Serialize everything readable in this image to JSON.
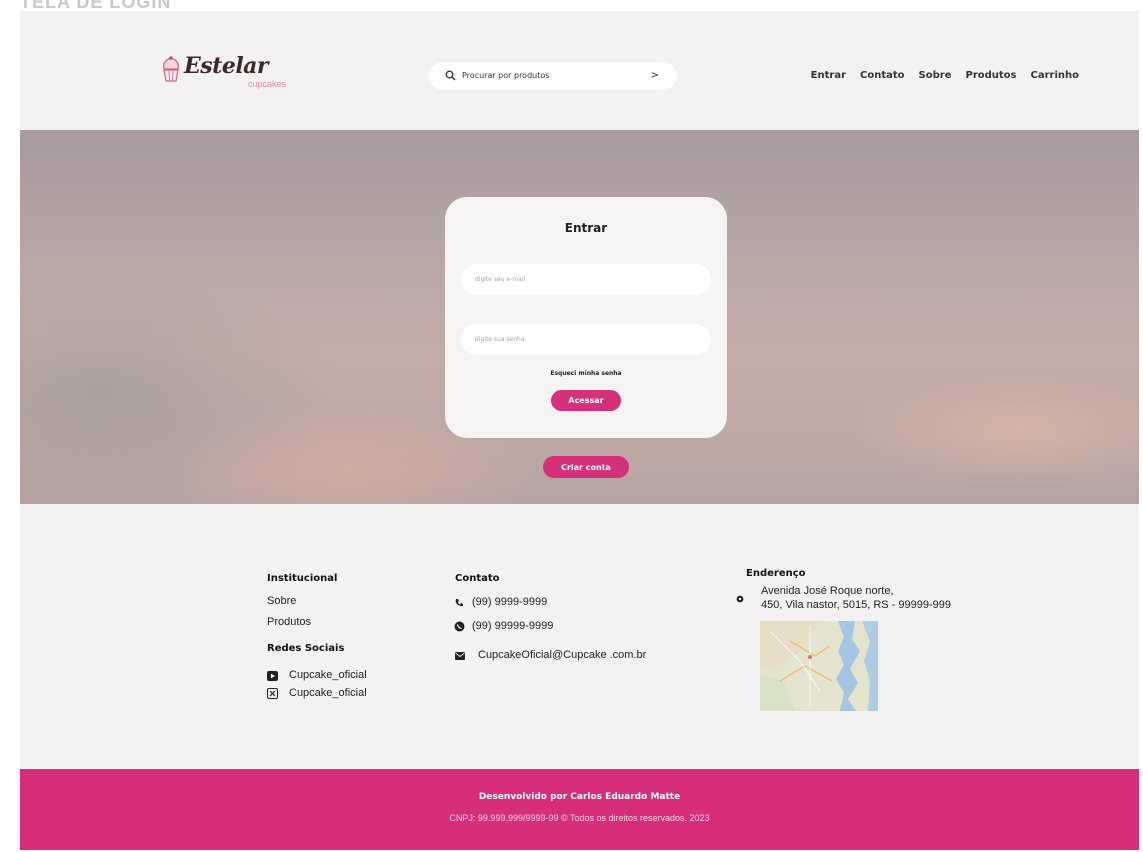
{
  "screen_label": "TELA DE LOGIN",
  "header": {
    "brand": {
      "name": "Estelar",
      "sub": "cupcakes"
    },
    "search": {
      "placeholder": "Procurar por produtos",
      "arrow": ">"
    },
    "nav": [
      "Entrar",
      "Contato",
      "Sobre",
      "Produtos",
      "Carrinho"
    ]
  },
  "login": {
    "title": "Entrar",
    "email_placeholder": "digite seu e-mail",
    "password_placeholder": "digite sua senha",
    "forgot": "Esqueci minha senha",
    "submit": "Acessar",
    "create_account": "Criar conta"
  },
  "info": {
    "institutional": {
      "title": "Institucional",
      "links": [
        "Sobre",
        "Produtos"
      ]
    },
    "social": {
      "title": "Redes Sociais",
      "items": [
        {
          "icon": "youtube-icon",
          "handle": "Cupcake_oficial"
        },
        {
          "icon": "x-icon",
          "handle": "Cupcake_oficial"
        }
      ]
    },
    "contact": {
      "title": "Contato",
      "items": [
        {
          "icon": "phone-icon",
          "text": "(99) 9999-9999"
        },
        {
          "icon": "whatsapp-icon",
          "text": "(99) 99999-9999"
        },
        {
          "icon": "mail-icon",
          "text": "CupcakeOficial@Cupcake .com.br"
        }
      ]
    },
    "address": {
      "title": "Enderenço",
      "line1": "Avenida José Roque norte,",
      "line2": "450, Vila nastor, 5015, RS  - 99999-999"
    }
  },
  "footer": {
    "developer": "Desenvolvido por Carlos Eduardo Matte",
    "legal": "CNPJ: 99.999.999/9999-99 © Todos os direitos reservados. 2023"
  },
  "colors": {
    "accent": "#d72e7b",
    "page_bg": "#f4f1f2",
    "card_bg": "#f6f3f4"
  }
}
